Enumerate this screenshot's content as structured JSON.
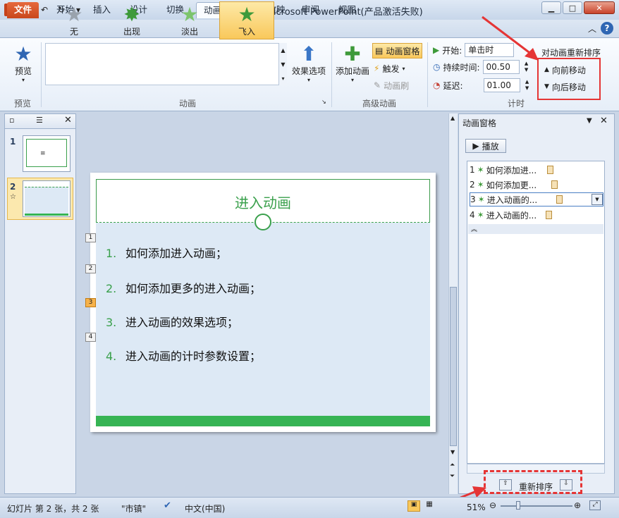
{
  "app": {
    "title": "进入动画.pptx - Microsoft PowerPoint(产品激活失败)",
    "logo_letter": "P"
  },
  "tabs": [
    {
      "label": "文件"
    },
    {
      "label": "开始"
    },
    {
      "label": "插入"
    },
    {
      "label": "设计"
    },
    {
      "label": "切换"
    },
    {
      "label": "动画"
    },
    {
      "label": "幻灯片放映"
    },
    {
      "label": "审阅"
    },
    {
      "label": "视图"
    }
  ],
  "ribbon": {
    "preview_label": "预览",
    "preview_group": "预览",
    "gallery": [
      {
        "label": "无"
      },
      {
        "label": "出现"
      },
      {
        "label": "淡出"
      },
      {
        "label": "飞入"
      }
    ],
    "effect_options_label": "效果选项",
    "animation_group": "动画",
    "add_animation_label": "添加动画",
    "animation_pane_label": "动画窗格",
    "trigger_label": "触发",
    "painter_label": "动画刷",
    "advanced_group": "高级动画",
    "start_label": "开始:",
    "start_value": "单击时",
    "duration_label": "持续时间:",
    "duration_value": "00.50",
    "delay_label": "延迟:",
    "delay_value": "01.00",
    "timing_group": "计时",
    "reorder_title": "对动画重新排序",
    "move_earlier": "向前移动",
    "move_later": "向后移动"
  },
  "slides_pane": {
    "slides": [
      {
        "num": "1"
      },
      {
        "num": "2"
      }
    ],
    "anim_marker": "☆"
  },
  "slide": {
    "title": "进入动画",
    "bullets": [
      {
        "num": "1.",
        "text": "如何添加进入动画；"
      },
      {
        "num": "2.",
        "text": "如何添加更多的进入动画；"
      },
      {
        "num": "3.",
        "text": "进入动画的效果选项；"
      },
      {
        "num": "4.",
        "text": "进入动画的计时参数设置；"
      }
    ],
    "anim_tags": [
      "1",
      "2",
      "3",
      "4"
    ]
  },
  "anim_pane": {
    "title": "动画窗格",
    "play_label": "播放",
    "items": [
      {
        "num": "1",
        "label": "如何添加进..."
      },
      {
        "num": "2",
        "label": "如何添加更..."
      },
      {
        "num": "3",
        "label": "进入动画的..."
      },
      {
        "num": "4",
        "label": "进入动画的..."
      }
    ],
    "reorder_label": "重新排序"
  },
  "status": {
    "slide_info": "幻灯片 第 2 张，共 2 张",
    "theme": "\"市镇\"",
    "language": "中文(中国)",
    "zoom": "51%"
  },
  "colors": {
    "accent_green": "#3aa04c",
    "file_tab": "#c9471c",
    "annotation_red": "#e53535"
  }
}
